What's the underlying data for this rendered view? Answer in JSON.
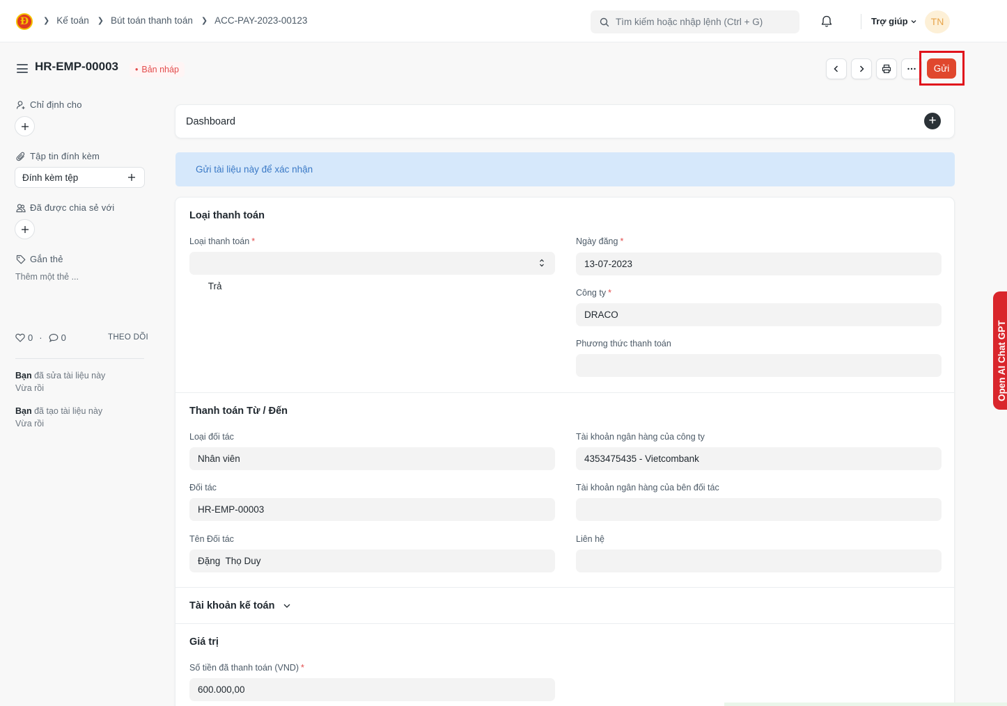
{
  "navbar": {
    "logo": "Đ",
    "breadcrumbs": [
      "Kế toán",
      "Bút toán thanh toán",
      "ACC-PAY-2023-00123"
    ],
    "search_placeholder": "Tìm kiếm hoặc nhập lệnh (Ctrl + G)",
    "help_label": "Trợ giúp",
    "avatar_initials": "TN"
  },
  "page": {
    "title": "HR-EMP-00003",
    "status": "Bản nháp",
    "submit_label": "Gửi"
  },
  "sidebar": {
    "assign_label": "Chỉ định cho",
    "attachments_label": "Tập tin đính kèm",
    "attach_button": "Đính kèm tệp",
    "shared_label": "Đã được chia sẻ với",
    "tags_label": "Gắn thẻ",
    "add_tag_hint": "Thêm một thẻ ...",
    "likes": "0",
    "dot": "·",
    "comments": "0",
    "follow_label": "THEO DÕI",
    "activity": [
      {
        "actor": "Bạn",
        "action": " đã sửa tài liệu này",
        "time": "Vừa rồi"
      },
      {
        "actor": "Bạn",
        "action": " đã tạo tài liệu này",
        "time": "Vừa rồi"
      }
    ]
  },
  "dashboard": {
    "title": "Dashboard",
    "plus": "+"
  },
  "info_message": "Gửi tài liệu này để xác nhận",
  "form": {
    "section_payment_type": {
      "title": "Loại thanh toán",
      "payment_type": {
        "label": "Loại thanh toán",
        "value": "Trả"
      },
      "posting_date": {
        "label": "Ngày đăng",
        "value": "13-07-2023"
      },
      "company": {
        "label": "Công ty",
        "value": "DRACO"
      },
      "mode_of_payment": {
        "label": "Phương thức thanh toán",
        "value": ""
      }
    },
    "section_party": {
      "title": "Thanh toán Từ / Đến",
      "party_type": {
        "label": "Loại đối tác",
        "value": "Nhân viên"
      },
      "company_bank_account": {
        "label": "Tài khoản ngân hàng của công ty",
        "value": "4353475435 - Vietcombank"
      },
      "party": {
        "label": "Đối tác",
        "value": "HR-EMP-00003"
      },
      "party_bank_account": {
        "label": "Tài khoản ngân hàng của bên đối tác",
        "value": ""
      },
      "party_name": {
        "label": "Tên Đối tác",
        "value": "Đặng  Thọ Duy"
      },
      "contact": {
        "label": "Liên hệ",
        "value": ""
      }
    },
    "section_accounts": {
      "title": "Tài khoản kế toán"
    },
    "section_amount": {
      "title": "Giá trị",
      "paid_amount": {
        "label": "Số tiền đã thanh toán (VND)",
        "value": "600.000,00"
      }
    },
    "required_mark": "*"
  },
  "side_tab": {
    "label": "Open AI Chat GPT"
  },
  "colors": {
    "primary": "#e0472d",
    "highlight_border": "#e0121b",
    "info_bg": "#d6e8fb",
    "draft": "#e24c4c"
  }
}
